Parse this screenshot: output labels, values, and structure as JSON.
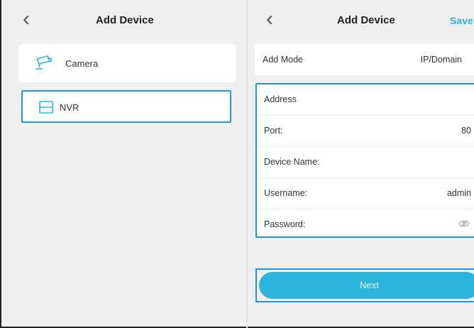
{
  "left": {
    "title": "Add Device",
    "items": [
      {
        "label": "Camera",
        "icon": "camera-icon"
      },
      {
        "label": "NVR",
        "icon": "nvr-icon"
      }
    ]
  },
  "right": {
    "title": "Add Device",
    "save_label": "Save",
    "add_mode": {
      "label": "Add Mode",
      "value": "IP/Domain"
    },
    "fields": [
      {
        "label": "Address",
        "value": ""
      },
      {
        "label": "Port:",
        "value": "80"
      },
      {
        "label": "Device Name:",
        "value": ""
      },
      {
        "label": "Username:",
        "value": "admin"
      },
      {
        "label": "Password:",
        "value": ""
      }
    ],
    "next_label": "Next"
  },
  "colors": {
    "accent": "#2bb5dc",
    "selection_border": "#2196d6",
    "background": "#efefef"
  }
}
